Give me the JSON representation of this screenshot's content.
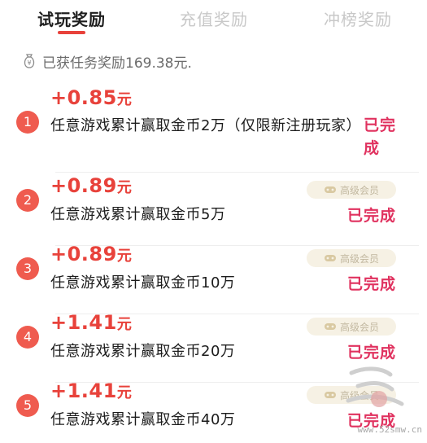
{
  "tabs": [
    {
      "label": "试玩奖励",
      "active": true
    },
    {
      "label": "充值奖励",
      "active": false
    },
    {
      "label": "冲榜奖励",
      "active": false
    }
  ],
  "summary": {
    "icon": "money-bag-icon",
    "text": "已获任务奖励169.38元."
  },
  "tasks": [
    {
      "index": "1",
      "amount": "+0.85",
      "unit": "元",
      "description": "任意游戏累计赢取金币2万（仅限新注册玩家）",
      "status": "已完成",
      "vip": null
    },
    {
      "index": "2",
      "amount": "+0.89",
      "unit": "元",
      "description": "任意游戏累计赢取金币5万",
      "status": "已完成",
      "vip": "高级会员"
    },
    {
      "index": "3",
      "amount": "+0.89",
      "unit": "元",
      "description": "任意游戏累计赢取金币10万",
      "status": "已完成",
      "vip": "高级会员"
    },
    {
      "index": "4",
      "amount": "+1.41",
      "unit": "元",
      "description": "任意游戏累计赢取金币20万",
      "status": "已完成",
      "vip": "高级会员"
    },
    {
      "index": "5",
      "amount": "+1.41",
      "unit": "元",
      "description": "任意游戏累计赢取金币40万",
      "status": "已完成",
      "vip": "高级会员"
    }
  ],
  "colors": {
    "accent": "#e8423b",
    "status": "#e0325f",
    "badge": "#ef5b4f"
  },
  "watermark": {
    "url": "www.52smw.cn"
  }
}
